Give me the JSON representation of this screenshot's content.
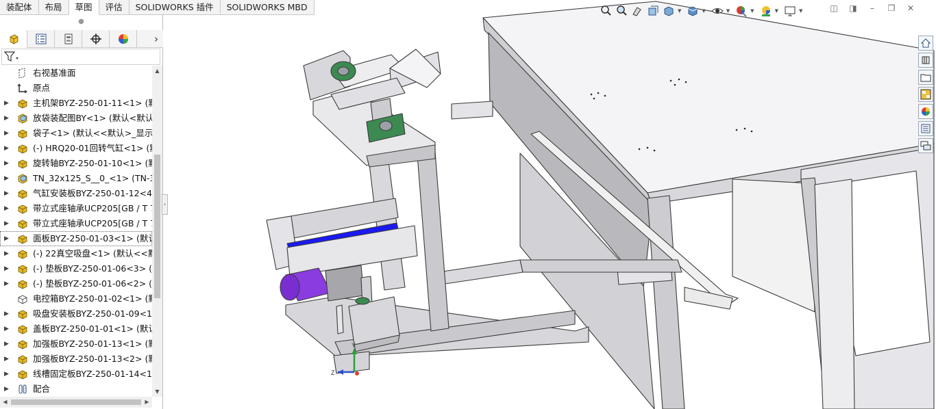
{
  "command_tabs": [
    {
      "label": "装配体",
      "active": false
    },
    {
      "label": "布局",
      "active": false
    },
    {
      "label": "草图",
      "active": true
    },
    {
      "label": "评估",
      "active": false
    },
    {
      "label": "SOLIDWORKS 插件",
      "active": false
    },
    {
      "label": "SOLIDWORKS MBD",
      "active": false
    }
  ],
  "panel_tabs": [
    {
      "name": "featuremanager-tab",
      "icon": "assembly-tree-icon"
    },
    {
      "name": "propertymanager-tab",
      "icon": "property-list-icon"
    },
    {
      "name": "configurationmanager-tab",
      "icon": "configuration-icon"
    },
    {
      "name": "dimxpert-tab",
      "icon": "crosshair-target-icon"
    },
    {
      "name": "displaymanager-tab",
      "icon": "color-wheel-icon"
    }
  ],
  "tree": {
    "items": [
      {
        "label": "右视基准面",
        "type": "plane",
        "arrow": false,
        "selected": false
      },
      {
        "label": "原点",
        "type": "origin",
        "arrow": false,
        "selected": false
      },
      {
        "label": "主机架BYZ-250-01-11<1> (默认<",
        "type": "part",
        "arrow": true,
        "selected": false
      },
      {
        "label": "放袋装配图BY<1> (默认<默认_显",
        "type": "assembly",
        "arrow": true,
        "selected": false
      },
      {
        "label": "袋子<1> (默认<<默认>_显示状",
        "type": "part",
        "arrow": true,
        "selected": false
      },
      {
        "label": "(-) HRQ20-01回转气缸<1> (默认",
        "type": "part",
        "arrow": true,
        "selected": false
      },
      {
        "label": "旋转轴BYZ-250-01-10<1> (默认",
        "type": "part",
        "arrow": true,
        "selected": false
      },
      {
        "label": "TN_32x125_S__0_<1> (TN-32x",
        "type": "assembly",
        "arrow": true,
        "selected": false
      },
      {
        "label": "气缸安装板BYZ-250-01-12<4> (",
        "type": "part",
        "arrow": true,
        "selected": false
      },
      {
        "label": "带立式座轴承UCP205[GB / T 78",
        "type": "part",
        "arrow": true,
        "selected": false
      },
      {
        "label": "带立式座轴承UCP205[GB / T 78",
        "type": "part",
        "arrow": true,
        "selected": false
      },
      {
        "label": "面板BYZ-250-01-03<1> (默认<<",
        "type": "part",
        "arrow": true,
        "selected": true
      },
      {
        "label": "(-) 22真空吸盘<1> (默认<<默认",
        "type": "part",
        "arrow": true,
        "selected": false
      },
      {
        "label": "(-) 垫板BYZ-250-01-06<3> (默",
        "type": "part",
        "arrow": true,
        "selected": false
      },
      {
        "label": "(-) 垫板BYZ-250-01-06<2> (默",
        "type": "part",
        "arrow": true,
        "selected": false
      },
      {
        "label": "电控箱BYZ-250-01-02<1> (默认",
        "type": "part-outline",
        "arrow": false,
        "selected": false
      },
      {
        "label": "吸盘安装板BYZ-250-01-09<1> (",
        "type": "part",
        "arrow": true,
        "selected": false
      },
      {
        "label": "盖板BYZ-250-01-01<1> (默认<",
        "type": "part",
        "arrow": true,
        "selected": false
      },
      {
        "label": "加强板BYZ-250-01-13<1> (默认",
        "type": "part",
        "arrow": true,
        "selected": false
      },
      {
        "label": "加强板BYZ-250-01-13<2> (默认",
        "type": "part",
        "arrow": true,
        "selected": false
      },
      {
        "label": "线槽固定板BYZ-250-01-14<1> (",
        "type": "part",
        "arrow": true,
        "selected": false
      },
      {
        "label": "配合",
        "type": "mates",
        "arrow": true,
        "selected": false
      }
    ]
  },
  "heads_up_toolbar": [
    "zoom-to-fit-icon",
    "zoom-to-area-icon",
    "previous-view-icon",
    "section-view-icon",
    "view-orientation-icon",
    "display-style-icon",
    "hide-show-items-icon",
    "edit-appearance-icon",
    "apply-scene-icon",
    "view-settings-icon"
  ],
  "task_pane": [
    "home-icon",
    "parts-library-icon",
    "file-explorer-icon",
    "view-palette-icon",
    "appearances-icon",
    "custom-properties-icon",
    "forum-icon"
  ],
  "triad": {
    "y_label": "Y",
    "z_label": "Z"
  },
  "colors": {
    "part_yellow": "#e8b820",
    "frame_gray": "#dcdcdc",
    "highlight_blue": "#1a1af0",
    "motor_purple": "#8a3ce0",
    "bearing_green": "#3c8a52"
  }
}
